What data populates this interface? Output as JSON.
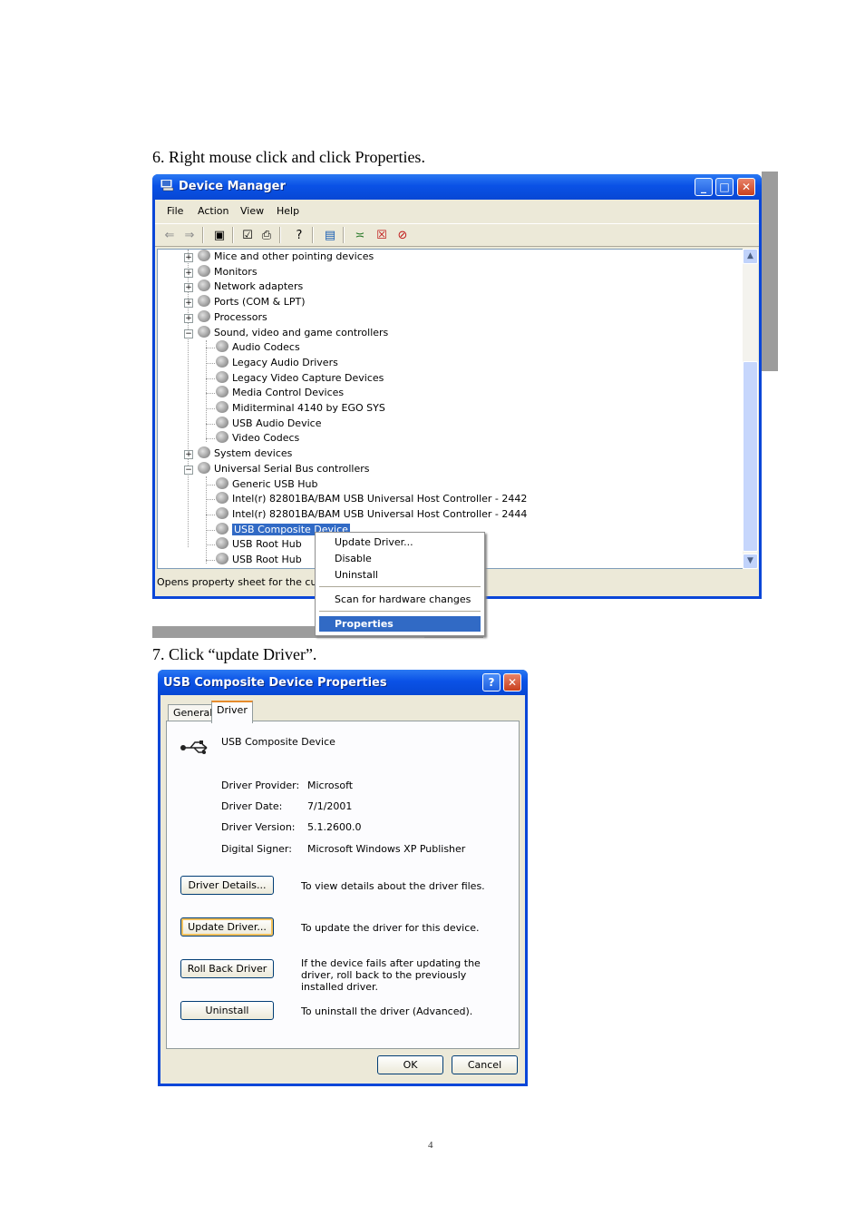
{
  "steps": {
    "step6": "6.   Right mouse click and click Properties.",
    "step7": "7.   Click “update Driver”."
  },
  "page_number": "4",
  "device_manager": {
    "title": "Device Manager",
    "menu": [
      "File",
      "Action",
      "View",
      "Help"
    ],
    "tree": [
      {
        "label": "Mice and other pointing devices",
        "expander": "+"
      },
      {
        "label": "Monitors",
        "expander": "+"
      },
      {
        "label": "Network adapters",
        "expander": "+"
      },
      {
        "label": "Ports (COM & LPT)",
        "expander": "+"
      },
      {
        "label": "Processors",
        "expander": "+"
      },
      {
        "label": "Sound, video and game controllers",
        "expander": "−"
      },
      {
        "label": "Audio Codecs"
      },
      {
        "label": "Legacy Audio Drivers"
      },
      {
        "label": "Legacy Video Capture Devices"
      },
      {
        "label": "Media Control Devices"
      },
      {
        "label": "Miditerminal 4140 by EGO SYS"
      },
      {
        "label": "USB Audio Device"
      },
      {
        "label": "Video Codecs"
      },
      {
        "label": "System devices",
        "expander": "+"
      },
      {
        "label": "Universal Serial Bus controllers",
        "expander": "−"
      },
      {
        "label": "Generic USB Hub"
      },
      {
        "label": "Intel(r) 82801BA/BAM USB Universal Host Controller - 2442"
      },
      {
        "label": "Intel(r) 82801BA/BAM USB Universal Host Controller - 2444"
      },
      {
        "label": "USB Composite Device"
      },
      {
        "label": "USB Root Hub"
      },
      {
        "label": "USB Root Hub"
      }
    ],
    "status": "Opens property sheet for the curr"
  },
  "context_menu": {
    "items": [
      "Update Driver...",
      "Disable",
      "Uninstall",
      "Scan for hardware changes",
      "Properties"
    ]
  },
  "properties_dialog": {
    "title": "USB Composite Device Properties",
    "tabs": [
      "General",
      "Driver"
    ],
    "device_name": "USB Composite Device",
    "fields": [
      {
        "label": "Driver Provider:",
        "value": "Microsoft"
      },
      {
        "label": "Driver Date:",
        "value": "7/1/2001"
      },
      {
        "label": "Driver Version:",
        "value": "5.1.2600.0"
      },
      {
        "label": "Digital Signer:",
        "value": "Microsoft Windows XP Publisher"
      }
    ],
    "actions": [
      {
        "button": "Driver Details...",
        "desc": "To view details about the driver files."
      },
      {
        "button": "Update Driver...",
        "desc": "To update the driver for this device."
      },
      {
        "button": "Roll Back Driver",
        "desc": "If the device fails after updating the driver, roll back to the previously installed driver."
      },
      {
        "button": "Uninstall",
        "desc": "To uninstall the driver (Advanced)."
      }
    ],
    "ok": "OK",
    "cancel": "Cancel"
  }
}
